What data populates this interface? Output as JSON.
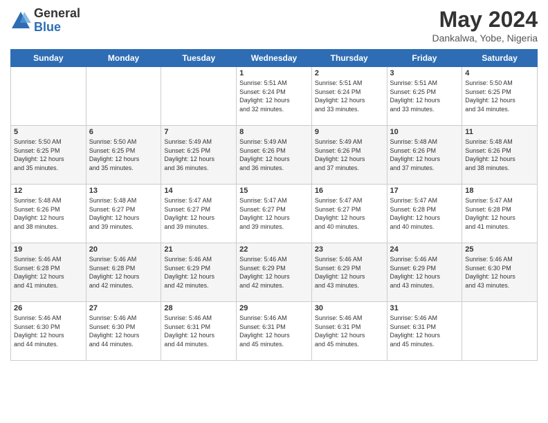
{
  "header": {
    "logo_general": "General",
    "logo_blue": "Blue",
    "month_title": "May 2024",
    "location": "Dankalwa, Yobe, Nigeria"
  },
  "weekdays": [
    "Sunday",
    "Monday",
    "Tuesday",
    "Wednesday",
    "Thursday",
    "Friday",
    "Saturday"
  ],
  "weeks": [
    [
      {
        "day": "",
        "info": ""
      },
      {
        "day": "",
        "info": ""
      },
      {
        "day": "",
        "info": ""
      },
      {
        "day": "1",
        "info": "Sunrise: 5:51 AM\nSunset: 6:24 PM\nDaylight: 12 hours\nand 32 minutes."
      },
      {
        "day": "2",
        "info": "Sunrise: 5:51 AM\nSunset: 6:24 PM\nDaylight: 12 hours\nand 33 minutes."
      },
      {
        "day": "3",
        "info": "Sunrise: 5:51 AM\nSunset: 6:25 PM\nDaylight: 12 hours\nand 33 minutes."
      },
      {
        "day": "4",
        "info": "Sunrise: 5:50 AM\nSunset: 6:25 PM\nDaylight: 12 hours\nand 34 minutes."
      }
    ],
    [
      {
        "day": "5",
        "info": "Sunrise: 5:50 AM\nSunset: 6:25 PM\nDaylight: 12 hours\nand 35 minutes."
      },
      {
        "day": "6",
        "info": "Sunrise: 5:50 AM\nSunset: 6:25 PM\nDaylight: 12 hours\nand 35 minutes."
      },
      {
        "day": "7",
        "info": "Sunrise: 5:49 AM\nSunset: 6:25 PM\nDaylight: 12 hours\nand 36 minutes."
      },
      {
        "day": "8",
        "info": "Sunrise: 5:49 AM\nSunset: 6:26 PM\nDaylight: 12 hours\nand 36 minutes."
      },
      {
        "day": "9",
        "info": "Sunrise: 5:49 AM\nSunset: 6:26 PM\nDaylight: 12 hours\nand 37 minutes."
      },
      {
        "day": "10",
        "info": "Sunrise: 5:48 AM\nSunset: 6:26 PM\nDaylight: 12 hours\nand 37 minutes."
      },
      {
        "day": "11",
        "info": "Sunrise: 5:48 AM\nSunset: 6:26 PM\nDaylight: 12 hours\nand 38 minutes."
      }
    ],
    [
      {
        "day": "12",
        "info": "Sunrise: 5:48 AM\nSunset: 6:26 PM\nDaylight: 12 hours\nand 38 minutes."
      },
      {
        "day": "13",
        "info": "Sunrise: 5:48 AM\nSunset: 6:27 PM\nDaylight: 12 hours\nand 39 minutes."
      },
      {
        "day": "14",
        "info": "Sunrise: 5:47 AM\nSunset: 6:27 PM\nDaylight: 12 hours\nand 39 minutes."
      },
      {
        "day": "15",
        "info": "Sunrise: 5:47 AM\nSunset: 6:27 PM\nDaylight: 12 hours\nand 39 minutes."
      },
      {
        "day": "16",
        "info": "Sunrise: 5:47 AM\nSunset: 6:27 PM\nDaylight: 12 hours\nand 40 minutes."
      },
      {
        "day": "17",
        "info": "Sunrise: 5:47 AM\nSunset: 6:28 PM\nDaylight: 12 hours\nand 40 minutes."
      },
      {
        "day": "18",
        "info": "Sunrise: 5:47 AM\nSunset: 6:28 PM\nDaylight: 12 hours\nand 41 minutes."
      }
    ],
    [
      {
        "day": "19",
        "info": "Sunrise: 5:46 AM\nSunset: 6:28 PM\nDaylight: 12 hours\nand 41 minutes."
      },
      {
        "day": "20",
        "info": "Sunrise: 5:46 AM\nSunset: 6:28 PM\nDaylight: 12 hours\nand 42 minutes."
      },
      {
        "day": "21",
        "info": "Sunrise: 5:46 AM\nSunset: 6:29 PM\nDaylight: 12 hours\nand 42 minutes."
      },
      {
        "day": "22",
        "info": "Sunrise: 5:46 AM\nSunset: 6:29 PM\nDaylight: 12 hours\nand 42 minutes."
      },
      {
        "day": "23",
        "info": "Sunrise: 5:46 AM\nSunset: 6:29 PM\nDaylight: 12 hours\nand 43 minutes."
      },
      {
        "day": "24",
        "info": "Sunrise: 5:46 AM\nSunset: 6:29 PM\nDaylight: 12 hours\nand 43 minutes."
      },
      {
        "day": "25",
        "info": "Sunrise: 5:46 AM\nSunset: 6:30 PM\nDaylight: 12 hours\nand 43 minutes."
      }
    ],
    [
      {
        "day": "26",
        "info": "Sunrise: 5:46 AM\nSunset: 6:30 PM\nDaylight: 12 hours\nand 44 minutes."
      },
      {
        "day": "27",
        "info": "Sunrise: 5:46 AM\nSunset: 6:30 PM\nDaylight: 12 hours\nand 44 minutes."
      },
      {
        "day": "28",
        "info": "Sunrise: 5:46 AM\nSunset: 6:31 PM\nDaylight: 12 hours\nand 44 minutes."
      },
      {
        "day": "29",
        "info": "Sunrise: 5:46 AM\nSunset: 6:31 PM\nDaylight: 12 hours\nand 45 minutes."
      },
      {
        "day": "30",
        "info": "Sunrise: 5:46 AM\nSunset: 6:31 PM\nDaylight: 12 hours\nand 45 minutes."
      },
      {
        "day": "31",
        "info": "Sunrise: 5:46 AM\nSunset: 6:31 PM\nDaylight: 12 hours\nand 45 minutes."
      },
      {
        "day": "",
        "info": ""
      }
    ]
  ]
}
